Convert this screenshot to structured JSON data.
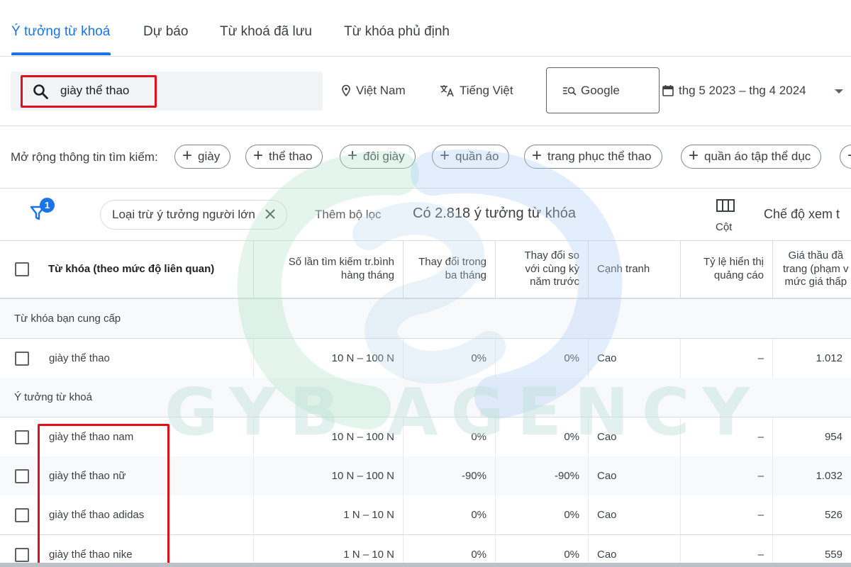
{
  "tabs": [
    {
      "label": "Ý tưởng từ khoá",
      "active": true
    },
    {
      "label": "Dự báo",
      "active": false
    },
    {
      "label": "Từ khoá đã lưu",
      "active": false
    },
    {
      "label": "Từ khóa phủ định",
      "active": false
    }
  ],
  "search": {
    "value": "giày thể thao"
  },
  "filters": {
    "location": "Việt Nam",
    "language": "Tiếng Việt",
    "network": "Google",
    "date_range": "thg 5 2023 – thg 4 2024"
  },
  "expand": {
    "label": "Mở rộng thông tin tìm kiếm:",
    "chips": [
      "giày",
      "thể thao",
      "đôi giày",
      "quần áo",
      "trang phục thể thao",
      "quần áo tập thể dục"
    ]
  },
  "toolbar": {
    "filter_badge": "1",
    "exclude_chip": "Loại trừ ý tưởng người lớn",
    "add_filter": "Thêm bộ lọc",
    "count_text": "Có 2.818 ý tưởng từ khóa",
    "columns_label": "Cột",
    "view_mode": "Chế độ xem t"
  },
  "table": {
    "headers": {
      "keyword": "Từ khóa (theo mức độ liên quan)",
      "avg_searches": [
        "Số lần tìm kiếm tr.bình",
        "hàng tháng"
      ],
      "three_month": [
        "Thay đổi trong",
        "ba tháng"
      ],
      "yoy": [
        "Thay đổi so",
        "với cùng kỳ",
        "năm trước"
      ],
      "competition": "Cạnh tranh",
      "impression_share": [
        "Tỷ lệ hiển thị",
        "quảng cáo"
      ],
      "bid": [
        "Giá thầu đầ",
        "trang (phạm v",
        "mức giá thấp"
      ]
    },
    "group_provided": "Từ khóa bạn cung cấp",
    "group_ideas": "Ý tưởng từ khoá",
    "provided_rows": [
      {
        "keyword": "giày thể thao",
        "searches": "10 N – 100 N",
        "three_month": "0%",
        "yoy": "0%",
        "competition": "Cao",
        "impression": "–",
        "bid": "1.012"
      }
    ],
    "idea_rows": [
      {
        "keyword": "giày thể thao nam",
        "searches": "10 N – 100 N",
        "three_month": "0%",
        "yoy": "0%",
        "competition": "Cao",
        "impression": "–",
        "bid": "954"
      },
      {
        "keyword": "giày thể thao nữ",
        "searches": "10 N – 100 N",
        "three_month": "-90%",
        "yoy": "-90%",
        "competition": "Cao",
        "impression": "–",
        "bid": "1.032"
      },
      {
        "keyword": "giày thể thao adidas",
        "searches": "1 N – 10 N",
        "three_month": "0%",
        "yoy": "0%",
        "competition": "Cao",
        "impression": "–",
        "bid": "526"
      },
      {
        "keyword": "giày thể thao nike",
        "searches": "1 N – 10 N",
        "three_month": "0%",
        "yoy": "0%",
        "competition": "Cao",
        "impression": "–",
        "bid": "559"
      }
    ]
  },
  "watermark": "GYB AGENCY",
  "colors": {
    "accent": "#1a73e8",
    "highlight": "#e0101a"
  }
}
